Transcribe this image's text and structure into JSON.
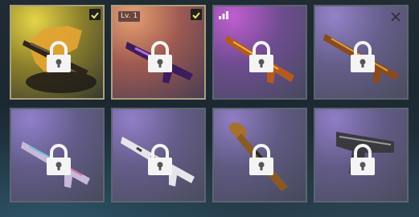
{
  "screen": "weapon-skin-selection",
  "colors": {
    "border": "#5b6670",
    "selected_border": "#a9a07c",
    "check_bg": "#202020",
    "check_mark": "#f2e36a",
    "lock": "#f4f4f4"
  },
  "tiles": [
    {
      "icon": "assault-rifle-skin-icon",
      "locked": true,
      "selected": true,
      "background": [
        "#dccb3d",
        "#7d7328",
        "#3a3a2a"
      ],
      "badge": null
    },
    {
      "icon": "assault-rifle-galaxy-skin-icon",
      "locked": true,
      "selected": true,
      "background": [
        "#e29a6e",
        "#9f5a52",
        "#4e3e52"
      ],
      "badge": "Lv. 1"
    },
    {
      "icon": "rifle-ornate-skin-icon",
      "locked": true,
      "selected": false,
      "background": [
        "#b15cc3",
        "#6d4a8c",
        "#4a4a60"
      ],
      "badge": "tier-icon"
    },
    {
      "icon": "sniper-rifle-skin-icon",
      "locked": true,
      "selected": false,
      "background": [
        "#8a78c0",
        "#625b86",
        "#4c4d60"
      ],
      "badge": "close-icon"
    },
    {
      "icon": "rifle-iridescent-skin-icon",
      "locked": true,
      "selected": false,
      "background": [
        "#8b79c6",
        "#605a86",
        "#4b4c5e"
      ],
      "badge": null
    },
    {
      "icon": "sniper-white-skin-icon",
      "locked": true,
      "selected": false,
      "background": [
        "#8c7ac5",
        "#625b86",
        "#4c4d60"
      ],
      "badge": null
    },
    {
      "icon": "rocket-launcher-skin-icon",
      "locked": true,
      "selected": false,
      "background": [
        "#8a78c0",
        "#5d5980",
        "#48495a"
      ],
      "badge": null
    },
    {
      "icon": "pistol-skin-icon",
      "locked": true,
      "selected": false,
      "background": [
        "#8b78c2",
        "#605a84",
        "#4b4c5e"
      ],
      "badge": null
    }
  ]
}
